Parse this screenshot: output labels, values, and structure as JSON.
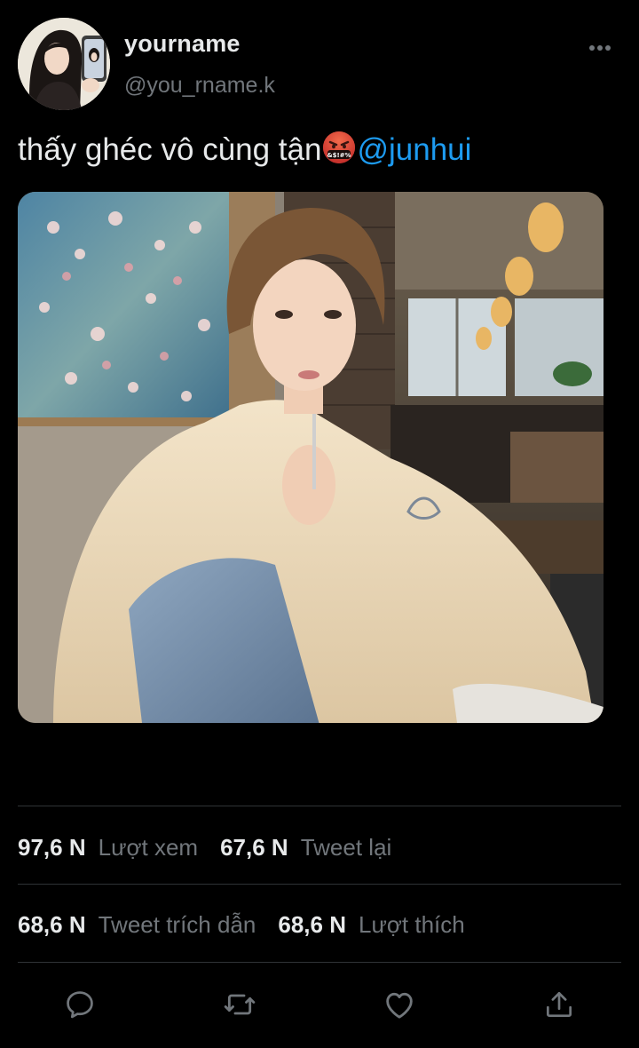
{
  "user": {
    "display_name": "yourname",
    "handle": "@you_rname.k",
    "avatar_icon": "avatar-photo"
  },
  "tweet": {
    "text": "thấy ghéc vô cùng tận",
    "emoji_icon": "face-with-symbols-on-mouth-icon",
    "mention": "@junhui",
    "media_icon": "photo"
  },
  "stats": {
    "views_value": "97,6 N",
    "views_label": "Lượt xem",
    "retweets_value": "67,6 N",
    "retweets_label": "Tweet lại",
    "quotes_value": "68,6 N",
    "quotes_label": "Tweet trích dẫn",
    "likes_value": "68,6 N",
    "likes_label": "Lượt thích"
  },
  "actions": {
    "icons": [
      "reply-icon",
      "retweet-icon",
      "like-icon",
      "share-icon"
    ]
  },
  "colors": {
    "background": "#000000",
    "text": "#e7e9ea",
    "muted": "#71767b",
    "accent": "#1d9bf0",
    "divider": "#2f3336"
  }
}
